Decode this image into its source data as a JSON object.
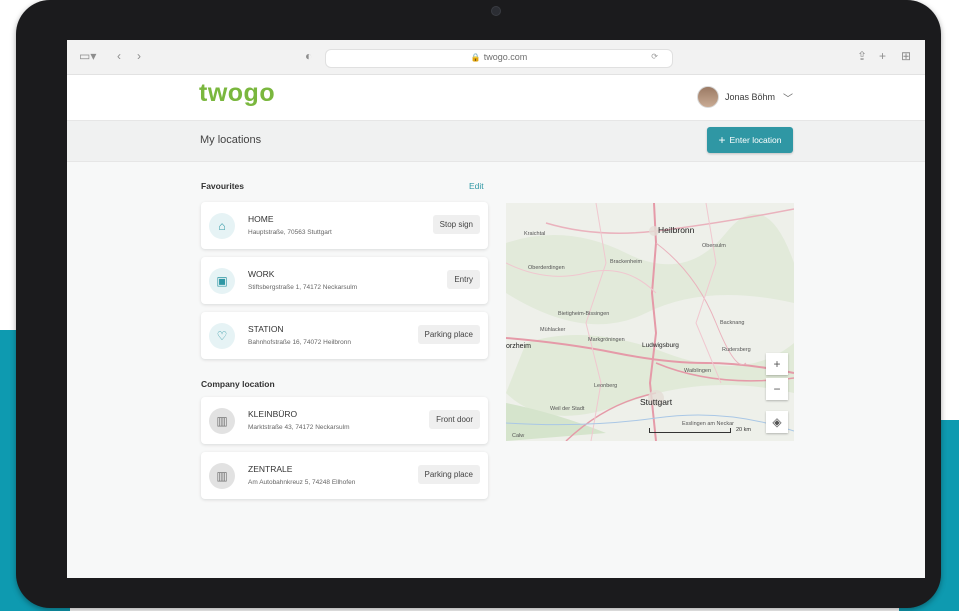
{
  "browser": {
    "url": "twogo.com"
  },
  "header": {
    "logo": "twogo",
    "user_name": "Jonas Böhm"
  },
  "subheader": {
    "title": "My locations",
    "enter_button": "Enter location"
  },
  "favourites": {
    "heading": "Favourites",
    "edit_label": "Edit",
    "items": [
      {
        "title": "HOME",
        "address": "Hauptstraße, 70563 Stuttgart",
        "tag": "Stop sign",
        "icon": "home-icon"
      },
      {
        "title": "WORK",
        "address": "Stiftsbergstraße 1, 74172 Neckarsulm",
        "tag": "Entry",
        "icon": "briefcase-icon"
      },
      {
        "title": "STATION",
        "address": "Bahnhofstraße 16, 74072 Heilbronn",
        "tag": "Parking place",
        "icon": "heart-icon"
      }
    ]
  },
  "company": {
    "heading": "Company location",
    "items": [
      {
        "title": "KLEINBÜRO",
        "address": "Marktstraße 43, 74172 Neckarsulm",
        "tag": "Front door",
        "icon": "building-icon"
      },
      {
        "title": "ZENTRALE",
        "address": "Am Autobahnkreuz 5, 74248 Ellhofen",
        "tag": "Parking place",
        "icon": "building-icon"
      }
    ]
  },
  "map": {
    "labels": [
      "Kraichtal",
      "Heilbronn",
      "Obersulm",
      "Oberderdingen",
      "Brackenheim",
      "Bietigheim-Bissingen",
      "Mühlacker",
      "Markgröningen",
      "Ludwigsburg",
      "Backnang",
      "Rudersberg",
      "Waiblingen",
      "Leonberg",
      "Weil der Stadt",
      "Stuttgart",
      "Esslingen am Neckar",
      "Calw",
      "orzheim"
    ],
    "scale_label": "20 km"
  },
  "colors": {
    "brand_green": "#7ab73e",
    "accent_teal": "#2f97a4"
  }
}
